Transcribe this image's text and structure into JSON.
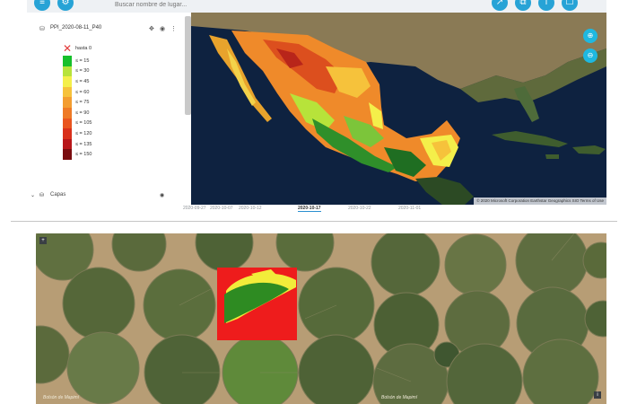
{
  "toolbar": {
    "search_placeholder": "Buscar nombre de lugar...",
    "left_icons": [
      "layers-icon",
      "settings-icon"
    ],
    "right_icons": [
      "share-icon",
      "copy-icon",
      "info-icon",
      "bookmark-icon"
    ]
  },
  "sidebar": {
    "layer_name": "PPI_2020-08-11_P40",
    "legend": {
      "none_label": "hasta 0",
      "items": [
        {
          "label": "≤ = 15",
          "color": "#17c02b"
        },
        {
          "label": "≤ = 30",
          "color": "#b7e33a"
        },
        {
          "label": "≤ = 45",
          "color": "#f4ef4a"
        },
        {
          "label": "≤ = 60",
          "color": "#f6c23b"
        },
        {
          "label": "≤ = 75",
          "color": "#f39d30"
        },
        {
          "label": "≤ = 90",
          "color": "#ee7a26"
        },
        {
          "label": "≤ = 105",
          "color": "#e9551f"
        },
        {
          "label": "≤ = 120",
          "color": "#d9301b"
        },
        {
          "label": "≤ = 135",
          "color": "#b8161a"
        },
        {
          "label": "≤ = 150",
          "color": "#7a0d10"
        }
      ]
    },
    "capas_label": "Capas"
  },
  "map": {
    "attribution": "© 2020 Microsoft Corporation Earthstar Geographics SIO Terms of Use"
  },
  "timeline": {
    "dates": [
      "2020-09-27",
      "2020-10-07",
      "2020-10-12",
      "2020-10-17",
      "2020-10-22",
      "2020-11-01"
    ],
    "active_index": 3
  },
  "satellite": {
    "caption_left": "Bolsón de Mapimí",
    "caption_right": "Bolsón de Mapimí",
    "colors": {
      "field_green": "#2e8b22",
      "field_red": "#ee1c1c",
      "field_yellow": "#f2ec3a"
    }
  }
}
